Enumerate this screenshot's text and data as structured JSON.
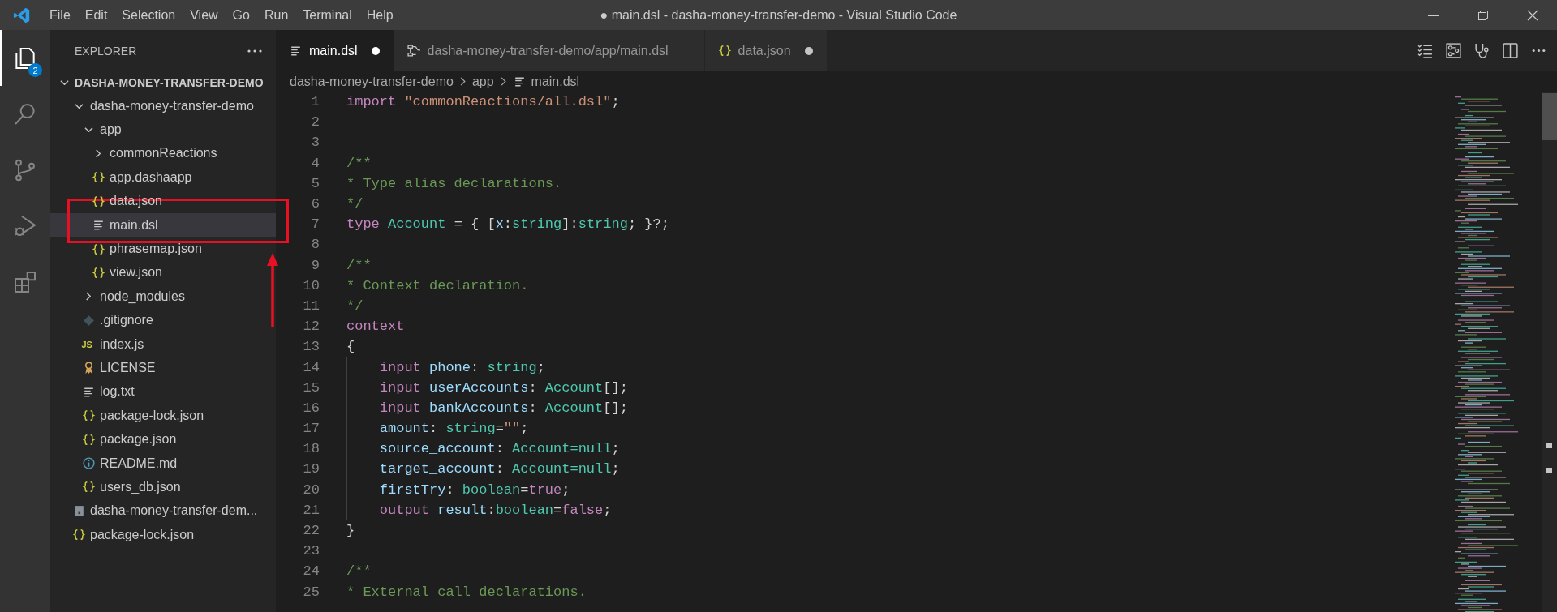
{
  "title_bar": {
    "menu": [
      "File",
      "Edit",
      "Selection",
      "View",
      "Go",
      "Run",
      "Terminal",
      "Help"
    ],
    "title": "● main.dsl - dasha-money-transfer-demo - Visual Studio Code"
  },
  "activity_bar": {
    "items": [
      {
        "kind": "explorer",
        "selected": true,
        "badge": "2"
      },
      {
        "kind": "search",
        "selected": false
      },
      {
        "kind": "source-control",
        "selected": false
      },
      {
        "kind": "run-debug",
        "selected": false
      },
      {
        "kind": "extensions",
        "selected": false
      }
    ]
  },
  "sidebar": {
    "title": "EXPLORER",
    "section": {
      "label": "DASHA-MONEY-TRANSFER-DEMO",
      "expanded": true
    },
    "tree": [
      {
        "label": "dasha-money-transfer-demo",
        "kind": "folder",
        "expanded": true,
        "selected": false,
        "children": [
          {
            "label": "app",
            "kind": "folder",
            "expanded": true,
            "selected": false,
            "children": [
              {
                "label": "commonReactions",
                "kind": "folder",
                "expanded": false,
                "selected": false
              },
              {
                "label": "app.dashaapp",
                "kind": "json",
                "selected": false
              },
              {
                "label": "data.json",
                "kind": "json",
                "selected": false
              },
              {
                "label": "main.dsl",
                "kind": "text",
                "selected": true
              },
              {
                "label": "phrasemap.json",
                "kind": "json",
                "selected": false
              },
              {
                "label": "view.json",
                "kind": "json",
                "selected": false
              }
            ]
          },
          {
            "label": "node_modules",
            "kind": "folder",
            "expanded": false,
            "selected": false
          },
          {
            "label": ".gitignore",
            "kind": "git",
            "selected": false
          },
          {
            "label": "index.js",
            "kind": "script",
            "icon_text": "JS",
            "selected": false
          },
          {
            "label": "LICENSE",
            "kind": "license",
            "selected": false
          },
          {
            "label": "log.txt",
            "kind": "text",
            "selected": false
          },
          {
            "label": "package-lock.json",
            "kind": "json",
            "selected": false
          },
          {
            "label": "package.json",
            "kind": "json",
            "selected": false
          },
          {
            "label": "README.md",
            "kind": "info",
            "selected": false
          },
          {
            "label": "users_db.json",
            "kind": "json",
            "selected": false
          }
        ]
      },
      {
        "label": "dasha-money-transfer-dem...",
        "kind": "archive",
        "selected": false
      },
      {
        "label": "package-lock.json",
        "kind": "json",
        "selected": false
      }
    ]
  },
  "tabs": [
    {
      "label": "main.dsl",
      "kind": "text",
      "selected": true,
      "modified": true
    },
    {
      "label": "dasha-money-transfer-demo/app/main.dsl",
      "kind": "graph",
      "selected": false,
      "modified": false
    },
    {
      "label": "data.json",
      "kind": "json",
      "selected": false,
      "modified": true
    }
  ],
  "breadcrumb": [
    {
      "label": "dasha-money-transfer-demo",
      "kind": "folder"
    },
    {
      "label": "app",
      "kind": "folder"
    },
    {
      "label": "main.dsl",
      "kind": "text"
    }
  ],
  "editor": {
    "lines": [
      {
        "number": "1",
        "tokens": [
          {
            "text": "import ",
            "kind": "keyword"
          },
          {
            "text": "\"commonReactions/all.dsl\"",
            "kind": "string"
          },
          {
            "text": ";",
            "kind": "plain"
          }
        ]
      },
      {
        "number": "2"
      },
      {
        "number": "3"
      },
      {
        "number": "4",
        "tokens": [
          {
            "text": "/**",
            "kind": "comment"
          }
        ]
      },
      {
        "number": "5",
        "tokens": [
          {
            "text": "* Type alias declarations.",
            "kind": "comment"
          }
        ]
      },
      {
        "number": "6",
        "tokens": [
          {
            "text": "*/",
            "kind": "comment"
          }
        ]
      },
      {
        "number": "7",
        "tokens": [
          {
            "text": "type ",
            "kind": "keyword"
          },
          {
            "text": "Account",
            "kind": "type"
          },
          {
            "text": " = { [",
            "kind": "plain"
          },
          {
            "text": "x",
            "kind": "variable"
          },
          {
            "text": ":",
            "kind": "plain"
          },
          {
            "text": "string",
            "kind": "type"
          },
          {
            "text": "]:",
            "kind": "plain"
          },
          {
            "text": "string",
            "kind": "type"
          },
          {
            "text": "; }?;",
            "kind": "plain"
          }
        ]
      },
      {
        "number": "8"
      },
      {
        "number": "9",
        "tokens": [
          {
            "text": "/**",
            "kind": "comment"
          }
        ]
      },
      {
        "number": "10",
        "tokens": [
          {
            "text": "* Context declaration.",
            "kind": "comment"
          }
        ]
      },
      {
        "number": "11",
        "tokens": [
          {
            "text": "*/",
            "kind": "comment"
          }
        ]
      },
      {
        "number": "12",
        "tokens": [
          {
            "text": "context",
            "kind": "keyword"
          }
        ]
      },
      {
        "number": "13",
        "tokens": [
          {
            "text": "{",
            "kind": "plain"
          }
        ],
        "children": [
          {
            "number": "14",
            "tokens": [
              {
                "text": "input ",
                "kind": "keyword"
              },
              {
                "text": "phone",
                "kind": "variable"
              },
              {
                "text": ": ",
                "kind": "plain"
              },
              {
                "text": "string",
                "kind": "type"
              },
              {
                "text": ";",
                "kind": "plain"
              }
            ]
          },
          {
            "number": "15",
            "tokens": [
              {
                "text": "input ",
                "kind": "keyword"
              },
              {
                "text": "userAccounts",
                "kind": "variable"
              },
              {
                "text": ": ",
                "kind": "plain"
              },
              {
                "text": "Account",
                "kind": "type"
              },
              {
                "text": "[];",
                "kind": "plain"
              }
            ]
          },
          {
            "number": "16",
            "tokens": [
              {
                "text": "input ",
                "kind": "keyword"
              },
              {
                "text": "bankAccounts",
                "kind": "variable"
              },
              {
                "text": ": ",
                "kind": "plain"
              },
              {
                "text": "Account",
                "kind": "type"
              },
              {
                "text": "[];",
                "kind": "plain"
              }
            ]
          },
          {
            "number": "17",
            "tokens": [
              {
                "text": "amount",
                "kind": "variable"
              },
              {
                "text": ": ",
                "kind": "plain"
              },
              {
                "text": "string",
                "kind": "type"
              },
              {
                "text": "=",
                "kind": "plain"
              },
              {
                "text": "\"\"",
                "kind": "string"
              },
              {
                "text": ";",
                "kind": "plain"
              }
            ]
          },
          {
            "number": "18",
            "tokens": [
              {
                "text": "source_account",
                "kind": "variable"
              },
              {
                "text": ": ",
                "kind": "plain"
              },
              {
                "text": "Account=null",
                "kind": "type"
              },
              {
                "text": ";",
                "kind": "plain"
              }
            ]
          },
          {
            "number": "19",
            "tokens": [
              {
                "text": "target_account",
                "kind": "variable"
              },
              {
                "text": ": ",
                "kind": "plain"
              },
              {
                "text": "Account=null",
                "kind": "type"
              },
              {
                "text": ";",
                "kind": "plain"
              }
            ]
          },
          {
            "number": "20",
            "tokens": [
              {
                "text": "firstTry",
                "kind": "variable"
              },
              {
                "text": ": ",
                "kind": "plain"
              },
              {
                "text": "boolean",
                "kind": "type"
              },
              {
                "text": "=",
                "kind": "plain"
              },
              {
                "text": "true",
                "kind": "keyword"
              },
              {
                "text": ";",
                "kind": "plain"
              }
            ]
          },
          {
            "number": "21",
            "tokens": [
              {
                "text": "output ",
                "kind": "keyword"
              },
              {
                "text": "result",
                "kind": "variable"
              },
              {
                "text": ":",
                "kind": "plain"
              },
              {
                "text": "boolean",
                "kind": "type"
              },
              {
                "text": "=",
                "kind": "plain"
              },
              {
                "text": "false",
                "kind": "keyword"
              },
              {
                "text": ";",
                "kind": "plain"
              }
            ]
          }
        ]
      },
      {
        "number": "22",
        "tokens": [
          {
            "text": "}",
            "kind": "plain"
          }
        ]
      },
      {
        "number": "23"
      },
      {
        "number": "24",
        "tokens": [
          {
            "text": "/**",
            "kind": "comment"
          }
        ]
      },
      {
        "number": "25",
        "tokens": [
          {
            "text": "* External call declarations.",
            "kind": "comment"
          }
        ]
      }
    ]
  },
  "annotation": {
    "highlight": true,
    "arrow": true
  }
}
